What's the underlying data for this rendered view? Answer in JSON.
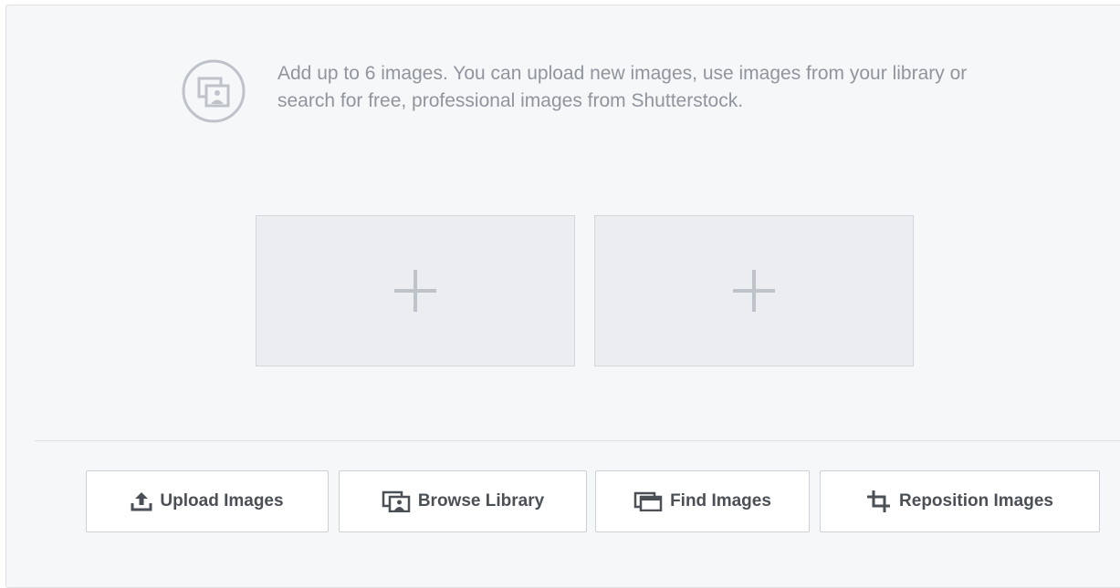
{
  "info": {
    "icon": "images-stack-icon",
    "text": "Add up to 6 images. You can upload new images, use images from your library or search for free, professional images from Shutterstock."
  },
  "slots": [
    {
      "icon": "plus-icon"
    },
    {
      "icon": "plus-icon"
    }
  ],
  "buttons": {
    "upload": {
      "label": "Upload Images",
      "icon": "upload-icon"
    },
    "browse": {
      "label": "Browse Library",
      "icon": "library-icon"
    },
    "find": {
      "label": "Find Images",
      "icon": "find-images-icon"
    },
    "reposition": {
      "label": "Reposition Images",
      "icon": "crop-icon"
    }
  },
  "colors": {
    "panel_bg": "#f6f7f9",
    "slot_bg": "#ebedf0",
    "text_muted": "#90949c",
    "button_text": "#4b4f56"
  }
}
